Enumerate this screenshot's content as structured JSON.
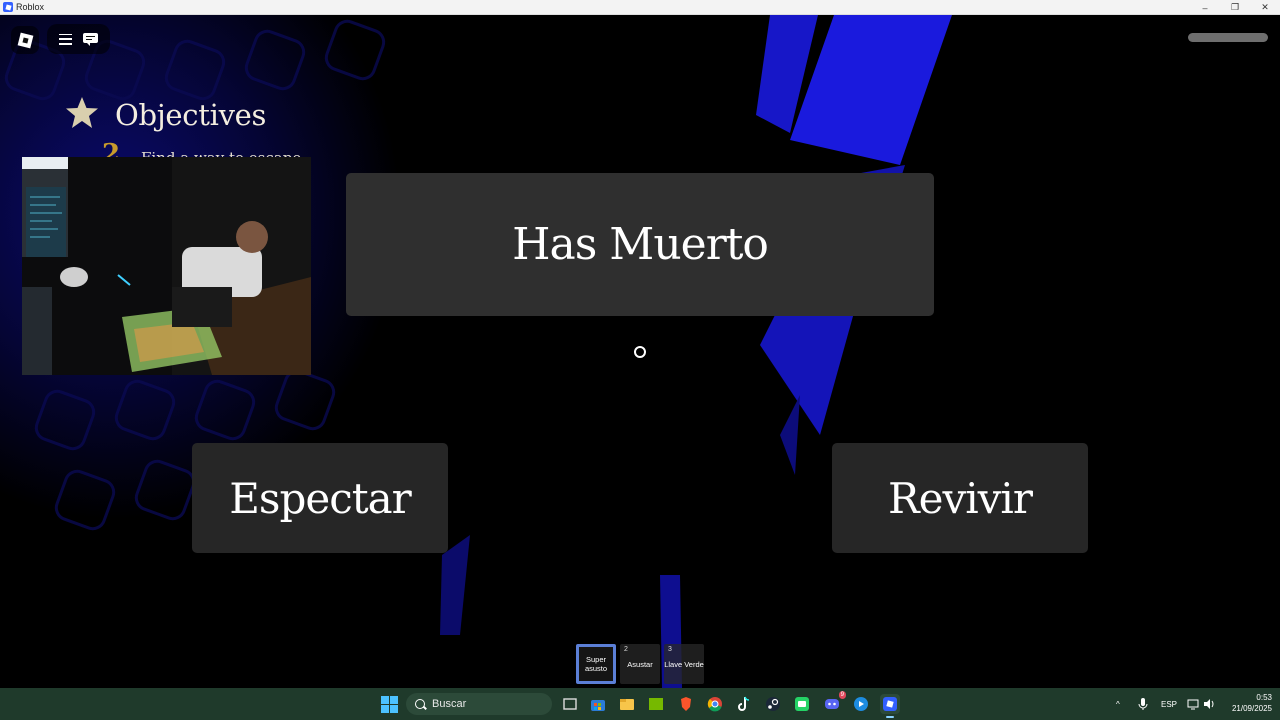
{
  "window": {
    "title": "Roblox",
    "controls": {
      "minimize": "–",
      "maximize": "❐",
      "close": "✕"
    }
  },
  "objectives": {
    "heading": "Objectives",
    "number": "2",
    "text": "Find a way to escape"
  },
  "death_screen": {
    "title": "Has Muerto",
    "spectate_label": "Espectar",
    "revive_label": "Revivir"
  },
  "hotbar": [
    {
      "number": "",
      "label": "Super asusto",
      "selected": true
    },
    {
      "number": "2",
      "label": "Asustar",
      "selected": false
    },
    {
      "number": "3",
      "label": "Llave Verde",
      "selected": false
    }
  ],
  "taskbar": {
    "search_placeholder": "Buscar",
    "tray_language": "ESP",
    "tray_chevron": "^",
    "clock_time": "0:53",
    "clock_date": "21/09/2025",
    "discord_badge": "9"
  },
  "colors": {
    "taskbar": "#1f3a2b",
    "accent_blue": "#1f1fd6",
    "panel": "#2f2f2f"
  }
}
